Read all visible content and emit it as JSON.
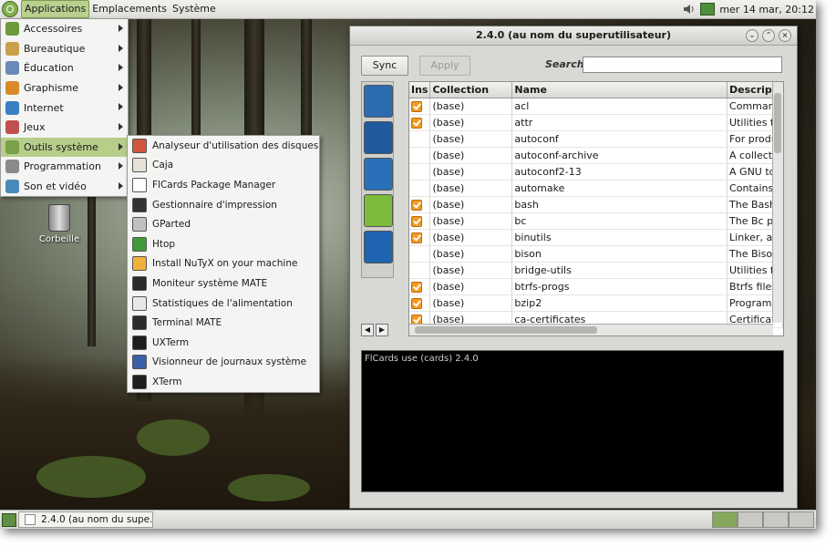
{
  "top_panel": {
    "menus": [
      "Applications",
      "Emplacements",
      "Système"
    ],
    "clock": "mer 14 mar, 20:12"
  },
  "apps_menu": {
    "items": [
      {
        "label": "Accessoires",
        "icon": "accessories-icon",
        "color": "#6f9a3c"
      },
      {
        "label": "Bureautique",
        "icon": "office-icon",
        "color": "#c9a04a"
      },
      {
        "label": "Éducation",
        "icon": "education-icon",
        "color": "#6a88b8"
      },
      {
        "label": "Graphisme",
        "icon": "graphics-icon",
        "color": "#d88a2a"
      },
      {
        "label": "Internet",
        "icon": "internet-icon",
        "color": "#3b7fc0"
      },
      {
        "label": "Jeux",
        "icon": "games-icon",
        "color": "#c05050"
      },
      {
        "label": "Outils système",
        "icon": "system-tools-icon",
        "color": "#7aa04a"
      },
      {
        "label": "Programmation",
        "icon": "programming-icon",
        "color": "#8a8a8a"
      },
      {
        "label": "Son et vidéo",
        "icon": "sound-video-icon",
        "color": "#4a8ab8"
      }
    ],
    "selected_index": 6
  },
  "system_menu": {
    "items": [
      {
        "label": "Analyseur d'utilisation des disques",
        "icon": "disk-usage-icon",
        "color": "#d0573c"
      },
      {
        "label": "Caja",
        "icon": "caja-icon",
        "color": "#e6e2d6"
      },
      {
        "label": "FlCards Package Manager",
        "icon": "flcards-icon",
        "color": "#ffffff"
      },
      {
        "label": "Gestionnaire d'impression",
        "icon": "printer-icon",
        "color": "#333333"
      },
      {
        "label": "GParted",
        "icon": "gparted-icon",
        "color": "#c0c0c0"
      },
      {
        "label": "Htop",
        "icon": "htop-icon",
        "color": "#3f9a3a"
      },
      {
        "label": "Install NuTyX on your machine",
        "icon": "install-icon",
        "color": "#f0b13c"
      },
      {
        "label": "Moniteur système MATE",
        "icon": "system-monitor-icon",
        "color": "#2a2a2a"
      },
      {
        "label": "Statistiques de l'alimentation",
        "icon": "power-stats-icon",
        "color": "#e8e8e8"
      },
      {
        "label": "Terminal MATE",
        "icon": "terminal-icon",
        "color": "#2b2b2b"
      },
      {
        "label": "UXTerm",
        "icon": "uxterm-icon",
        "color": "#1e1e1e"
      },
      {
        "label": "Visionneur de journaux système",
        "icon": "log-viewer-icon",
        "color": "#3a5fa8"
      },
      {
        "label": "XTerm",
        "icon": "xterm-icon",
        "color": "#1e1e1e"
      }
    ]
  },
  "desktop": {
    "trash_label": "Corbeille"
  },
  "window": {
    "title": "2.4.0 (au nom du superutilisateur)",
    "sync_label": "Sync",
    "apply_label": "Apply",
    "search_label": "Search:",
    "search_value": "",
    "side_icons": [
      {
        "name": "arch-icon",
        "color": "#2b6cb0"
      },
      {
        "name": "hand-icon",
        "color": "#1f5a9c"
      },
      {
        "name": "bird-icon",
        "color": "#2a70b8"
      },
      {
        "name": "mate-icon",
        "color": "#7dbb3a"
      },
      {
        "name": "kde-icon",
        "color": "#1e64b0"
      }
    ],
    "columns": [
      "Ins",
      "Collection",
      "Name",
      "Descript"
    ],
    "rows": [
      {
        "ins": true,
        "collection": "(base)",
        "name": "acl",
        "desc": "Comman"
      },
      {
        "ins": true,
        "collection": "(base)",
        "name": "attr",
        "desc": "Utilities to"
      },
      {
        "ins": false,
        "collection": "(base)",
        "name": "autoconf",
        "desc": "For produ"
      },
      {
        "ins": false,
        "collection": "(base)",
        "name": "autoconf-archive",
        "desc": "A collecti"
      },
      {
        "ins": false,
        "collection": "(base)",
        "name": "autoconf2-13",
        "desc": "A GNU to"
      },
      {
        "ins": false,
        "collection": "(base)",
        "name": "automake",
        "desc": "Contains"
      },
      {
        "ins": true,
        "collection": "(base)",
        "name": "bash",
        "desc": "The Bash"
      },
      {
        "ins": true,
        "collection": "(base)",
        "name": "bc",
        "desc": "The Bc p"
      },
      {
        "ins": true,
        "collection": "(base)",
        "name": "binutils",
        "desc": "Linker, a"
      },
      {
        "ins": false,
        "collection": "(base)",
        "name": "bison",
        "desc": "The Bison"
      },
      {
        "ins": false,
        "collection": "(base)",
        "name": "bridge-utils",
        "desc": "Utilities fo"
      },
      {
        "ins": true,
        "collection": "(base)",
        "name": "btrfs-progs",
        "desc": "Btrfs files"
      },
      {
        "ins": true,
        "collection": "(base)",
        "name": "bzip2",
        "desc": "Program"
      },
      {
        "ins": true,
        "collection": "(base)",
        "name": "ca-certificates",
        "desc": "Certificat"
      }
    ],
    "console_text": "FlCards use  (cards) 2.4.0"
  },
  "bottom_panel": {
    "task_label": "2.4.0 (au nom du supe..."
  }
}
